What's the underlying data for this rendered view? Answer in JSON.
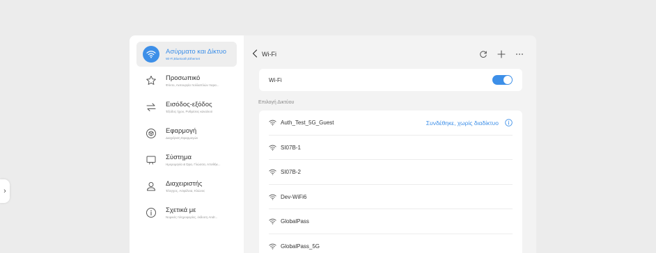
{
  "colors": {
    "accent": "#3d8fe8",
    "background": "#ececec"
  },
  "edge_tab": {
    "label": "›"
  },
  "sidebar": {
    "items": [
      {
        "title": "Ασύρματο και Δίκτυο",
        "subtitle": "Wi-Fi,Bluetooth,Ethernet",
        "icon": "wifi-icon",
        "active": true
      },
      {
        "title": "Προσωπικό",
        "subtitle": "Φόντο, Λειτουργία πολλαπλών παρα...",
        "icon": "star-icon",
        "active": false
      },
      {
        "title": "Εισόδος-εξόδος",
        "subtitle": "Έξοδος ήχου, Ρυθμίσεις καναλιού",
        "icon": "swap-arrows-icon",
        "active": false
      },
      {
        "title": "Εφαρμογή",
        "subtitle": "Διαχείριση Εφαρμογών",
        "icon": "cube-icon",
        "active": false
      },
      {
        "title": "Σύστημα",
        "subtitle": "Ημερομηνία & Ώρα, Γλώσσα, Αποθήκ...",
        "icon": "monitor-icon",
        "active": false
      },
      {
        "title": "Διαχειριστής",
        "subtitle": "Έλεγχος, Ασφάλεια, Κλώνος",
        "icon": "user-icon",
        "active": false
      },
      {
        "title": "Σχετικά με",
        "subtitle": "Νομικές πληροφορίες, έκδοση Andr...",
        "icon": "info-icon",
        "active": false
      }
    ]
  },
  "header": {
    "title": "Wi-Fi",
    "back_icon": "chevron-left-icon",
    "actions": [
      "refresh-icon",
      "plus-icon",
      "more-icon"
    ]
  },
  "wifi_toggle": {
    "label": "Wi-Fi",
    "enabled": true
  },
  "section": {
    "label": "Επιλογή Δικτύου"
  },
  "networks": [
    {
      "name": "Auth_Test_5G_Guest",
      "status": "Συνδέθηκε, χωρίς διαδίκτυο"
    },
    {
      "name": "SI07B-1"
    },
    {
      "name": "SI07B-2"
    },
    {
      "name": "Dev-WiFi6"
    },
    {
      "name": "GlobalPass"
    },
    {
      "name": "GlobalPass_5G"
    }
  ]
}
